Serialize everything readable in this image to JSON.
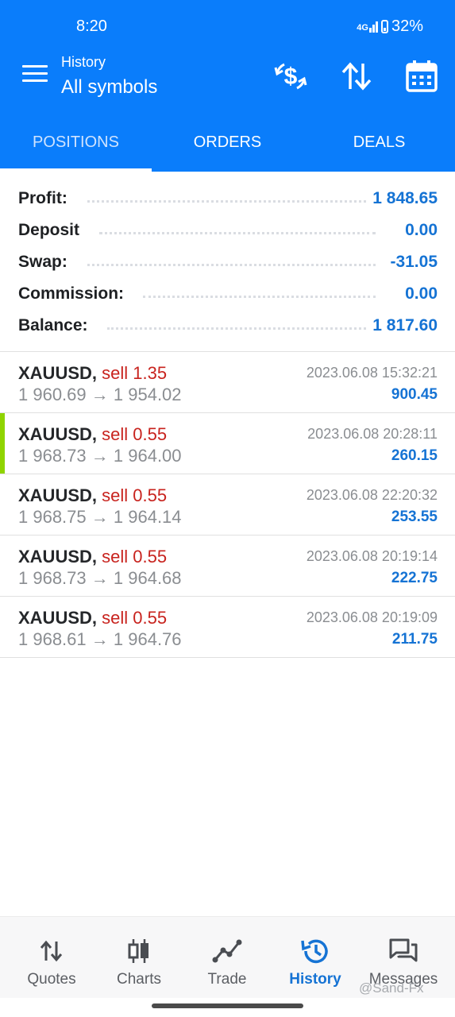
{
  "status_bar": {
    "time": "8:20",
    "network": "4G",
    "battery": "32%"
  },
  "app_bar": {
    "subtitle": "History",
    "title": "All symbols",
    "actions": [
      "currency-exchange-icon",
      "sort-icon",
      "calendar-icon"
    ]
  },
  "tabs": [
    {
      "label": "POSITIONS",
      "active": true
    },
    {
      "label": "ORDERS",
      "active": false
    },
    {
      "label": "DEALS",
      "active": false
    }
  ],
  "summary": [
    {
      "label": "Profit:",
      "value": "1 848.65"
    },
    {
      "label": "Deposit",
      "value": "0.00"
    },
    {
      "label": "Swap:",
      "value": "-31.05"
    },
    {
      "label": "Commission:",
      "value": "0.00"
    },
    {
      "label": "Balance:",
      "value": "1 817.60"
    }
  ],
  "deals": [
    {
      "symbol": "XAUUSD,",
      "side": "sell 1.35",
      "open": "1 960.69",
      "arrow": "→",
      "close": "1 954.02",
      "time": "2023.06.08 15:32:21",
      "profit": "900.45",
      "highlighted": false
    },
    {
      "symbol": "XAUUSD,",
      "side": "sell 0.55",
      "open": "1 968.73",
      "arrow": "→",
      "close": "1 964.00",
      "time": "2023.06.08 20:28:11",
      "profit": "260.15",
      "highlighted": true
    },
    {
      "symbol": "XAUUSD,",
      "side": "sell 0.55",
      "open": "1 968.75",
      "arrow": "→",
      "close": "1 964.14",
      "time": "2023.06.08 22:20:32",
      "profit": "253.55",
      "highlighted": false
    },
    {
      "symbol": "XAUUSD,",
      "side": "sell 0.55",
      "open": "1 968.73",
      "arrow": "→",
      "close": "1 964.68",
      "time": "2023.06.08 20:19:14",
      "profit": "222.75",
      "highlighted": false
    },
    {
      "symbol": "XAUUSD,",
      "side": "sell 0.55",
      "open": "1 968.61",
      "arrow": "→",
      "close": "1 964.76",
      "time": "2023.06.08 20:19:09",
      "profit": "211.75",
      "highlighted": false
    }
  ],
  "bottom_nav": [
    {
      "label": "Quotes",
      "icon": "quotes-icon",
      "active": false
    },
    {
      "label": "Charts",
      "icon": "charts-icon",
      "active": false
    },
    {
      "label": "Trade",
      "icon": "trade-icon",
      "active": false
    },
    {
      "label": "History",
      "icon": "history-icon",
      "active": true
    },
    {
      "label": "Messages",
      "icon": "messages-icon",
      "active": false
    }
  ],
  "watermark": "@Sand-Fx",
  "colors": {
    "primary": "#0a7dfb",
    "profit": "#1573d4",
    "sell": "#c8231e",
    "highlight": "#8fd400"
  }
}
